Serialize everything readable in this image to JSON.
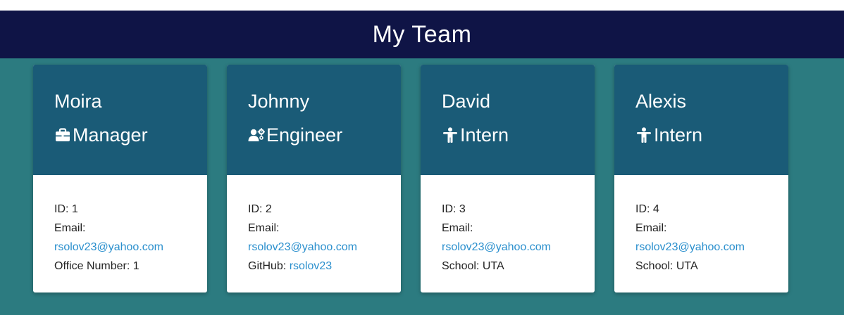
{
  "header": {
    "title": "My Team"
  },
  "colors": {
    "background": "#2c7b80",
    "header_bg": "#0f1446",
    "card_head_bg": "#1a5b77",
    "link": "#2a8fcd"
  },
  "cards": [
    {
      "name": "Moira",
      "role": "Manager",
      "role_icon": "briefcase-icon",
      "id_text": "ID: 1",
      "email_label": "Email:",
      "email": "rsolov23@yahoo.com",
      "extra_label": "Office Number: 1",
      "extra_link": ""
    },
    {
      "name": "Johnny",
      "role": "Engineer",
      "role_icon": "user-cog-icon",
      "id_text": "ID: 2",
      "email_label": "Email:",
      "email": "rsolov23@yahoo.com",
      "extra_label": "GitHub: ",
      "extra_link": "rsolov23"
    },
    {
      "name": "David",
      "role": "Intern",
      "role_icon": "child-icon",
      "id_text": "ID: 3",
      "email_label": "Email:",
      "email": "rsolov23@yahoo.com",
      "extra_label": "School: UTA",
      "extra_link": ""
    },
    {
      "name": "Alexis",
      "role": "Intern",
      "role_icon": "child-icon",
      "id_text": "ID: 4",
      "email_label": "Email:",
      "email": "rsolov23@yahoo.com",
      "extra_label": "School: UTA",
      "extra_link": ""
    }
  ]
}
